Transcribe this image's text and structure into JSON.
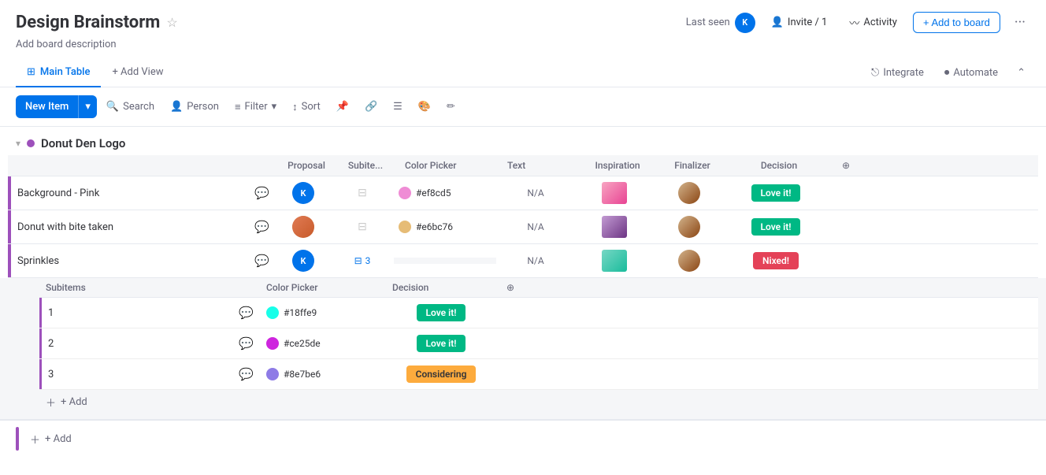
{
  "header": {
    "title": "Design Brainstorm",
    "subtitle": "Add board description",
    "last_seen_label": "Last seen",
    "avatar_initial": "K",
    "invite_label": "Invite / 1",
    "activity_label": "Activity",
    "add_board_label": "+ Add to board"
  },
  "tabs": {
    "main_table_label": "Main Table",
    "add_view_label": "+ Add View",
    "integrate_label": "Integrate",
    "automate_label": "Automate"
  },
  "toolbar": {
    "new_item_label": "New Item",
    "search_label": "Search",
    "person_label": "Person",
    "filter_label": "Filter",
    "sort_label": "Sort"
  },
  "group": {
    "title": "Donut Den Logo",
    "color": "#9d50bb"
  },
  "columns": {
    "item_name": "",
    "proposal": "Proposal",
    "subitems": "Subite...",
    "color_picker": "Color Picker",
    "text": "Text",
    "inspiration": "Inspiration",
    "finalizer": "Finalizer",
    "decision": "Decision"
  },
  "rows": [
    {
      "name": "Background - Pink",
      "proposal_color": "#0073ea",
      "proposal_initial": "K",
      "subitems": "",
      "color_hex": "#ef8cd5",
      "color_dot": "#ef8cd5",
      "text": "N/A",
      "decision": "Love it!",
      "decision_type": "green"
    },
    {
      "name": "Donut with bite taken",
      "proposal_color": "#e07b54",
      "proposal_initial": "",
      "subitems": "",
      "color_hex": "#e6bc76",
      "color_dot": "#e6bc76",
      "text": "N/A",
      "decision": "Love it!",
      "decision_type": "green"
    },
    {
      "name": "Sprinkles",
      "proposal_color": "#0073ea",
      "proposal_initial": "K",
      "subitems": "3",
      "color_hex": "",
      "color_dot": "",
      "text": "N/A",
      "decision": "Nixed!",
      "decision_type": "red"
    }
  ],
  "subitems": {
    "header": {
      "name": "Subitems",
      "color_picker": "Color Picker",
      "decision": "Decision"
    },
    "rows": [
      {
        "name": "1",
        "color_hex": "#18ffe9",
        "color_dot": "#18ffe9",
        "decision": "Love it!",
        "decision_type": "green"
      },
      {
        "name": "2",
        "color_hex": "#ce25de",
        "color_dot": "#ce25de",
        "decision": "Love it!",
        "decision_type": "green"
      },
      {
        "name": "3",
        "color_hex": "#8e7be6",
        "color_dot": "#8e7be6",
        "decision": "Considering",
        "decision_type": "orange"
      }
    ],
    "add_label": "+ Add"
  },
  "add_group_label": "+ Add"
}
